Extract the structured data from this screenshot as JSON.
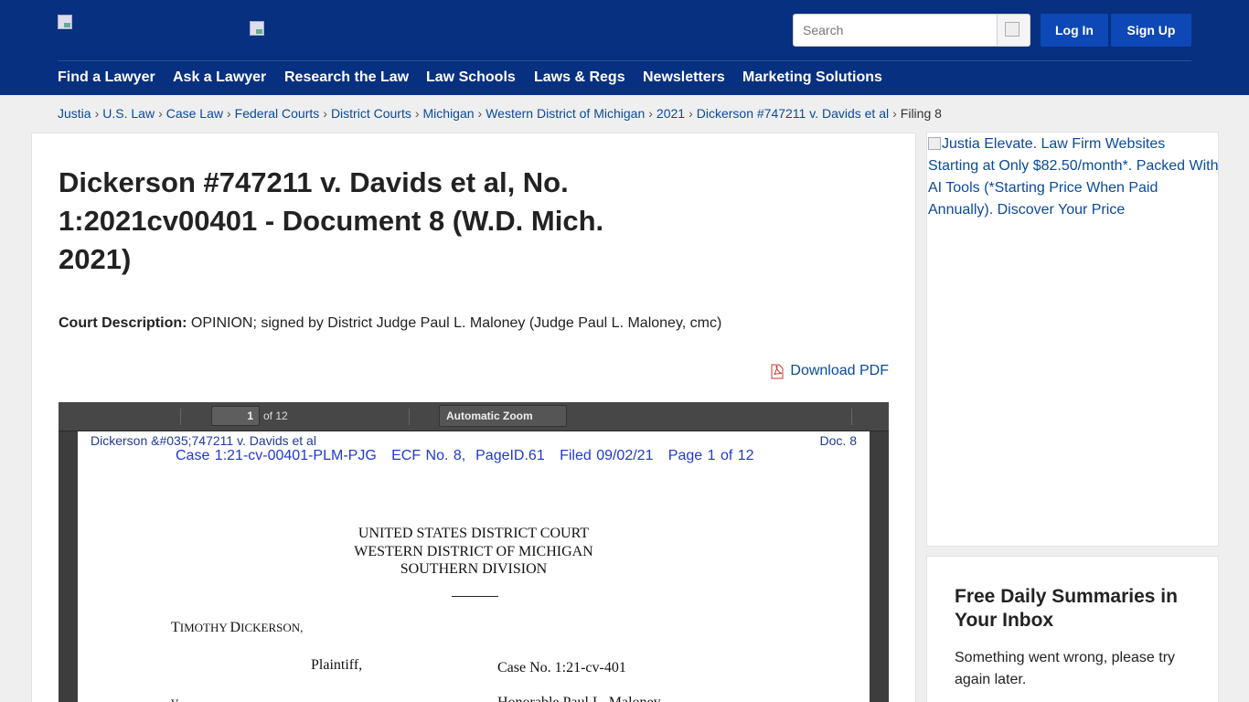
{
  "header": {
    "search_placeholder": "Search",
    "login_label": "Log In",
    "signup_label": "Sign Up",
    "nav": [
      "Find a Lawyer",
      "Ask a Lawyer",
      "Research the Law",
      "Law Schools",
      "Laws & Regs",
      "Newsletters",
      "Marketing Solutions"
    ]
  },
  "breadcrumb": [
    "Justia",
    "U.S. Law",
    "Case Law",
    "Federal Courts",
    "District Courts",
    "Michigan",
    "Western District of Michigan",
    "2021",
    "Dickerson #747211 v. Davids et al"
  ],
  "breadcrumb_current": "Filing 8",
  "breadcrumb_sep": "›",
  "doc": {
    "title": "Dickerson #747211 v. Davids et al, No. 1:2021cv00401 - Document 8 (W.D. Mich. 2021)",
    "desc_label": "Court Description:",
    "desc_text": "OPINION; signed by District Judge Paul L. Maloney (Judge Paul L. Maloney, cmc)",
    "download_label": "Download PDF"
  },
  "viewer": {
    "page_number": "1",
    "page_of": "of 12",
    "zoom": "Automatic Zoom",
    "header_left": "Dickerson &#035;747211 v. Davids et al",
    "header_right": "Doc. 8",
    "case_line": "Case 1:21-cv-00401-PLM-PJG   ECF No. 8,  PageID.61   Filed 09/02/21   Page 1 of 12",
    "court_line1": "UNITED STATES DISTRICT COURT",
    "court_line2": "WESTERN DISTRICT OF MICHIGAN",
    "court_line3": "SOUTHERN DIVISION",
    "party_first": "T",
    "party_rest": "IMOTHY ",
    "party_last_first": "D",
    "party_last_rest": "ICKERSON,",
    "role": "Plaintiff,",
    "case_no": "Case No. 1:21-cv-401",
    "v": "v.",
    "honorable": "Honorable Paul L. Maloney"
  },
  "sidebar": {
    "ad_alt": "Justia Elevate. Law Firm Websites Starting at Only $82.50/month*. Packed With AI Tools (*Starting Price When Paid Annually). Discover Your Price",
    "newsletter_title": "Free Daily Summaries in Your Inbox",
    "newsletter_msg": "Something went wrong, please try again later."
  },
  "colors": {
    "header_bg": "#073080",
    "button_bg": "#0d48b6",
    "link": "#0a4a9a"
  }
}
